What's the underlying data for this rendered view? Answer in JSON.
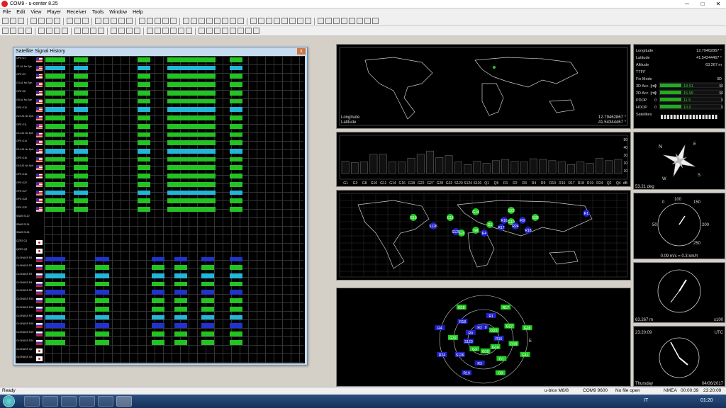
{
  "window": {
    "title": "COM9 - u-center 8.25",
    "minimize": "─",
    "maximize": "□",
    "close": "✕"
  },
  "menu": [
    "File",
    "Edit",
    "View",
    "Player",
    "Receiver",
    "Tools",
    "Window",
    "Help"
  ],
  "ssh": {
    "title": "Satellite Signal History",
    "close": "x",
    "rows": [
      {
        "label": "GPS G1",
        "flag": "us"
      },
      {
        "label": "G1 A1 No Eph",
        "flag": "us"
      },
      {
        "label": "GPS G3",
        "flag": "us"
      },
      {
        "label": "G3 A1 No Eph",
        "flag": "us"
      },
      {
        "label": "GPS G8",
        "flag": "us"
      },
      {
        "label": "G8 A1 No Eph",
        "flag": "us"
      },
      {
        "label": "GPS G10",
        "flag": "us"
      },
      {
        "label": "G10 A1 No Eph",
        "flag": "us"
      },
      {
        "label": "GPS G11",
        "flag": "us"
      },
      {
        "label": "G11 A1 No Eph",
        "flag": "us"
      },
      {
        "label": "GPS G14",
        "flag": "us"
      },
      {
        "label": "G14 A1 No Eph",
        "flag": "us"
      },
      {
        "label": "GPS G16",
        "flag": "us"
      },
      {
        "label": "G16 A1 No Eph",
        "flag": "us"
      },
      {
        "label": "GPS G18",
        "flag": "us"
      },
      {
        "label": "GPS G22",
        "flag": "us"
      },
      {
        "label": "GPS G27",
        "flag": "us"
      },
      {
        "label": "GPS G28",
        "flag": "us"
      },
      {
        "label": "GPS G32",
        "flag": "us"
      },
      {
        "label": "SBAS S120",
        "flag": ""
      },
      {
        "label": "SBAS S124",
        "flag": ""
      },
      {
        "label": "SBAS S126",
        "flag": ""
      },
      {
        "label": "QZSS Q1",
        "flag": "jp"
      },
      {
        "label": "QZSS Q5",
        "flag": "jp"
      },
      {
        "label": "GLONASS R1",
        "flag": "ru"
      },
      {
        "label": "GLONASS R2",
        "flag": "ru"
      },
      {
        "label": "GLONASS R3",
        "flag": "ru"
      },
      {
        "label": "GLONASS R4",
        "flag": "ru"
      },
      {
        "label": "GLONASS R9",
        "flag": "ru"
      },
      {
        "label": "GLONASS R10",
        "flag": "ru"
      },
      {
        "label": "GLONASS R16",
        "flag": "ru"
      },
      {
        "label": "GLONASS R17",
        "flag": "ru"
      },
      {
        "label": "GLONASS R18",
        "flag": "ru"
      },
      {
        "label": "GLONASS R19",
        "flag": "ru"
      },
      {
        "label": "GLONASS R24",
        "flag": "ru"
      },
      {
        "label": "GLONASS Q2",
        "flag": "jp"
      },
      {
        "label": "GLONASS Q4",
        "flag": "jp"
      }
    ]
  },
  "world_top": {
    "longitude_label": "Longitude",
    "longitude_value": "12.79462867 °",
    "latitude_label": "Latitude",
    "latitude_value": "41.54344467 °"
  },
  "signal_bars": {
    "labels": [
      "G1",
      "G3",
      "G8",
      "G10",
      "G11",
      "G14",
      "G16",
      "G18",
      "G22",
      "G27",
      "G28",
      "G32",
      "S120",
      "S124",
      "S126",
      "Q1",
      "Q5",
      "R1",
      "R2",
      "R3",
      "R4",
      "R9",
      "R10",
      "R16",
      "R17",
      "R18",
      "R19",
      "R24",
      "Q2",
      "Q4"
    ],
    "scale": [
      "50",
      "40",
      "30",
      "20",
      "10"
    ],
    "unit": "dB",
    "values": [
      19,
      17,
      18,
      30,
      30,
      18,
      18,
      24,
      30,
      35,
      25,
      28,
      18,
      14,
      19,
      16,
      20,
      22,
      19,
      18,
      23,
      22,
      20,
      18,
      14,
      18,
      16,
      24,
      20,
      22
    ]
  },
  "map_sats": [
    {
      "id": "G16",
      "c": "g"
    },
    {
      "id": "G11",
      "c": "g"
    },
    {
      "id": "G14",
      "c": "g"
    },
    {
      "id": "G22",
      "c": "g"
    },
    {
      "id": "G1",
      "c": "g"
    },
    {
      "id": "G8",
      "c": "g"
    },
    {
      "id": "G10",
      "c": "g"
    },
    {
      "id": "G3",
      "c": "g"
    },
    {
      "id": "G32",
      "c": "g"
    },
    {
      "id": "S120",
      "c": "b"
    },
    {
      "id": "R4",
      "c": "b"
    },
    {
      "id": "R17",
      "c": "b"
    },
    {
      "id": "R24",
      "c": "b"
    },
    {
      "id": "R9",
      "c": "b"
    },
    {
      "id": "R16",
      "c": "b"
    },
    {
      "id": "R18",
      "c": "b"
    },
    {
      "id": "R1",
      "c": "b"
    },
    {
      "id": "S126",
      "c": "b"
    }
  ],
  "sky_sats": [
    {
      "id": "R10",
      "c": "b"
    },
    {
      "id": "R1",
      "c": "b"
    },
    {
      "id": "R17",
      "c": "g"
    },
    {
      "id": "G22",
      "c": "g"
    },
    {
      "id": "G27",
      "c": "g"
    },
    {
      "id": "G28",
      "c": "g"
    },
    {
      "id": "R16",
      "c": "b"
    },
    {
      "id": "G18",
      "c": "g"
    },
    {
      "id": "G11",
      "c": "g"
    },
    {
      "id": "G14",
      "c": "g"
    },
    {
      "id": "G1",
      "c": "g"
    },
    {
      "id": "G8",
      "c": "g"
    },
    {
      "id": "G10",
      "c": "g"
    },
    {
      "id": "R3",
      "c": "b"
    },
    {
      "id": "R19",
      "c": "b"
    },
    {
      "id": "G3",
      "c": "g"
    },
    {
      "id": "S126",
      "c": "b"
    },
    {
      "id": "R24",
      "c": "b"
    },
    {
      "id": "S120",
      "c": "b"
    },
    {
      "id": "G32",
      "c": "g"
    },
    {
      "id": "R4",
      "c": "b"
    },
    {
      "id": "R9",
      "c": "b"
    },
    {
      "id": "R18",
      "c": "b"
    },
    {
      "id": "G16",
      "c": "g"
    },
    {
      "id": "R2",
      "c": "b"
    }
  ],
  "data_panel": {
    "rows": [
      {
        "k": "Longitude",
        "v": "12.79462867 °"
      },
      {
        "k": "Latitude",
        "v": "41.54344467 °"
      },
      {
        "k": "Altitude",
        "v": "63.267 m"
      },
      {
        "k": "TTFF",
        "v": ""
      },
      {
        "k": "Fix Mode",
        "v": "3D"
      },
      {
        "k": "3D Acc. [m]",
        "v": "18.91",
        "lo": "0",
        "hi": "50"
      },
      {
        "k": "2D Acc. [m]",
        "v": "15.99",
        "lo": "0",
        "hi": "50"
      },
      {
        "k": "PDOP",
        "v": "11.5",
        "lo": "0",
        "hi": "5"
      },
      {
        "k": "HDOP",
        "v": "10.0",
        "lo": "0",
        "hi": "5"
      },
      {
        "k": "Satellites",
        "v": ""
      }
    ]
  },
  "compass": {
    "n": "N",
    "e": "E",
    "s": "S",
    "w": "W",
    "heading": "53.21 deg"
  },
  "speedo": {
    "t0": "0",
    "t50": "50",
    "t100": "100",
    "t150": "150",
    "t200": "200",
    "t250": "250",
    "readout": "0.09 m/s = 0.3 km/h"
  },
  "altimeter": {
    "readout": "63.267 m",
    "scale": "x100"
  },
  "clock": {
    "time": "23:20:09",
    "zone": "UTC",
    "day": "Thursday",
    "date": "04/06/2017"
  },
  "status": {
    "ready": "Ready",
    "device": "u-blox M8/8",
    "port": "COM9 9600",
    "file": "No file open",
    "proto": "NMEA",
    "t1": "00:00:39",
    "t2": "23:20:09"
  },
  "tray": {
    "lang": "IT",
    "time": "01:20"
  }
}
